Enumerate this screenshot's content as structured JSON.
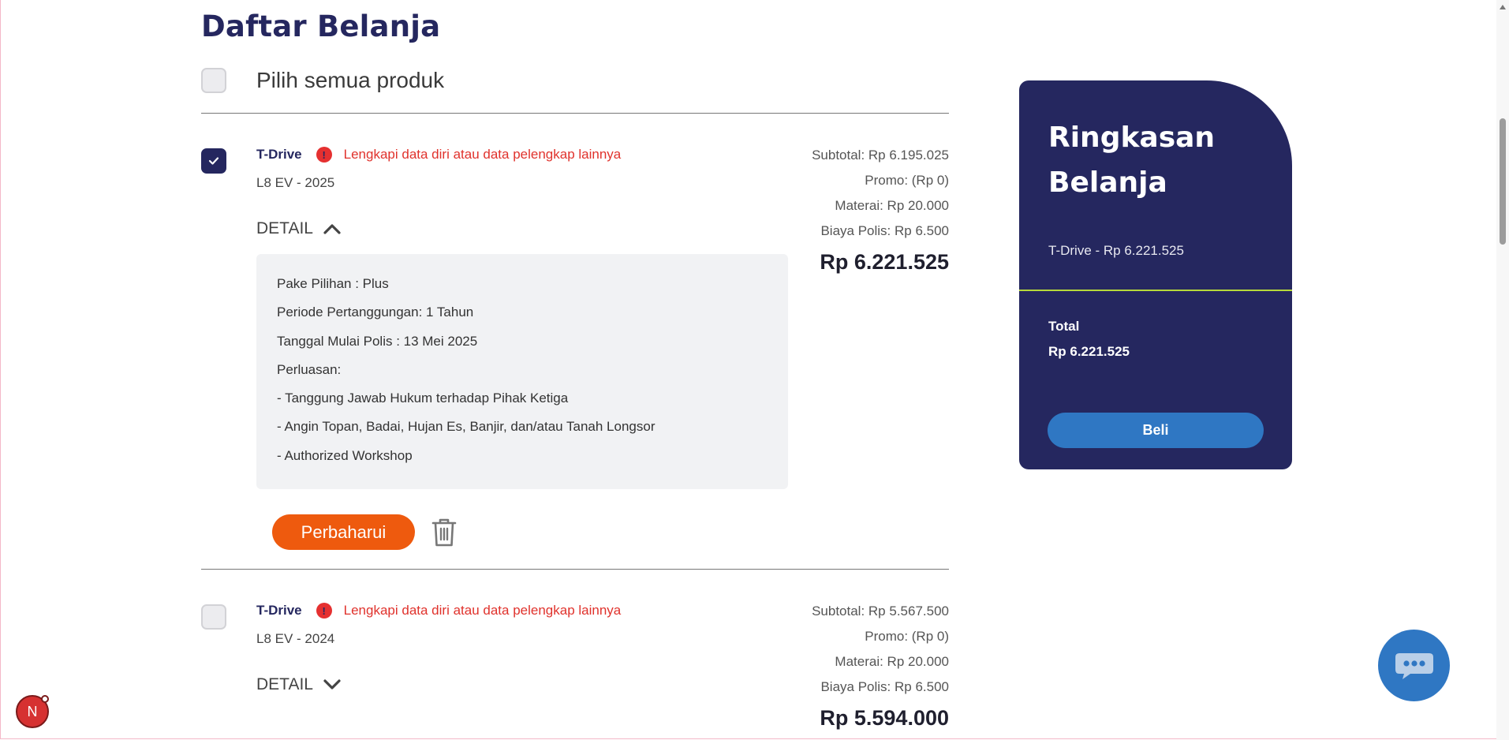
{
  "page": {
    "title": "Daftar Belanja"
  },
  "select_all": {
    "label": "Pilih semua produk",
    "checked": false
  },
  "items": [
    {
      "checked": true,
      "product": "T-Drive",
      "warning": "Lengkapi data diri atau data pelengkap lainnya",
      "model": "L8 EV - 2025",
      "detail_label": "DETAIL",
      "expanded": true,
      "subtotal": "Subtotal: Rp 6.195.025",
      "promo": "Promo: (Rp 0)",
      "materai": "Materai: Rp 20.000",
      "biaya_polis": "Biaya Polis: Rp 6.500",
      "total": "Rp 6.221.525",
      "details": [
        "Pake Pilihan : Plus",
        "Periode Pertanggungan: 1 Tahun",
        "Tanggal Mulai Polis : 13 Mei 2025",
        "Perluasan:",
        "- Tanggung Jawab Hukum terhadap Pihak Ketiga",
        "- Angin Topan, Badai, Hujan Es, Banjir, dan/atau Tanah Longsor",
        "- Authorized Workshop"
      ],
      "update_label": "Perbaharui"
    },
    {
      "checked": false,
      "product": "T-Drive",
      "warning": "Lengkapi data diri atau data pelengkap lainnya",
      "model": "L8 EV - 2024",
      "detail_label": "DETAIL",
      "expanded": false,
      "subtotal": "Subtotal: Rp 5.567.500",
      "promo": "Promo: (Rp 0)",
      "materai": "Materai: Rp 20.000",
      "biaya_polis": "Biaya Polis: Rp 6.500",
      "total": "Rp 5.594.000"
    }
  ],
  "summary": {
    "title_line1": "Ringkasan",
    "title_line2": "Belanja",
    "item": "T-Drive - Rp 6.221.525",
    "total_label": "Total",
    "total_value": "Rp 6.221.525",
    "buy_label": "Beli"
  },
  "badge": {
    "letter": "N"
  },
  "colors": {
    "navy": "#25275f",
    "orange": "#ee5a0e",
    "blue": "#2f77c3",
    "warning_red": "#e0322c",
    "accent_line": "#b6d93b"
  },
  "icons": [
    "check-icon",
    "alert-icon",
    "chevron-up-icon",
    "chevron-down-icon",
    "trash-icon",
    "chat-icon"
  ]
}
